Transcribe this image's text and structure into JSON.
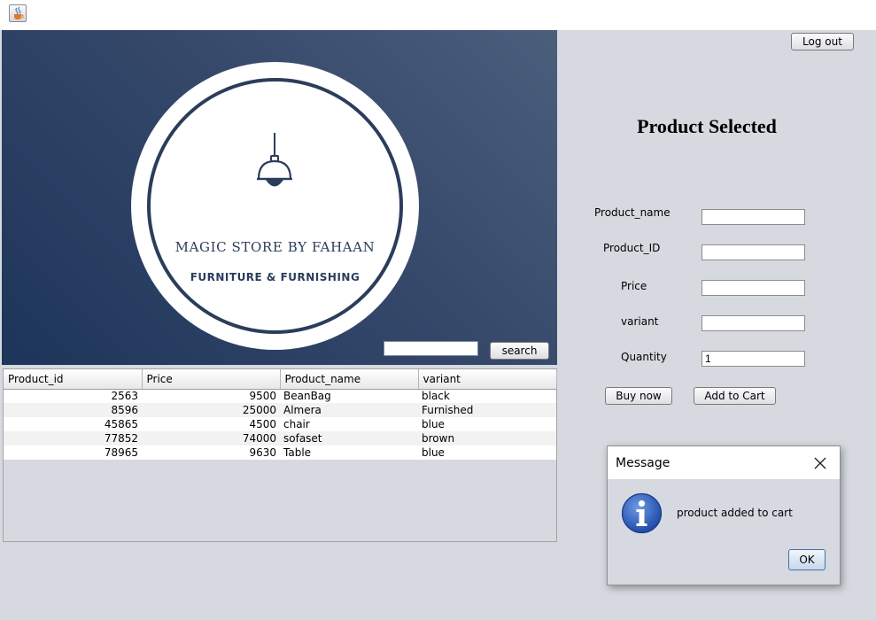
{
  "window": {
    "icon": "java-cup-icon"
  },
  "banner": {
    "logo_icon": "lamp-icon",
    "logo_title": "MAGIC STORE BY FAHAAN",
    "logo_subtitle": "FURNITURE & FURNISHING",
    "search_value": "",
    "search_button": "search"
  },
  "table": {
    "columns": [
      "Product_id",
      "Price",
      "Product_name",
      "variant"
    ],
    "rows": [
      [
        "2563",
        "9500",
        "BeanBag",
        "black"
      ],
      [
        "8596",
        "25000",
        "Almera",
        "Furnished"
      ],
      [
        "45865",
        "4500",
        "chair",
        "blue"
      ],
      [
        "77852",
        "74000",
        "sofaset",
        "brown"
      ],
      [
        "78965",
        "9630",
        "Table",
        "blue"
      ]
    ]
  },
  "panel": {
    "logout": "Log out",
    "heading": "Product Selected",
    "fields": [
      {
        "label": "Product_name",
        "value": ""
      },
      {
        "label": "Product_ID",
        "value": ""
      },
      {
        "label": "Price",
        "value": ""
      },
      {
        "label": "variant",
        "value": ""
      },
      {
        "label": "Quantity",
        "value": "1"
      }
    ],
    "buy_now": "Buy now",
    "add_to_cart": "Add to Cart"
  },
  "dialog": {
    "title": "Message",
    "icon": "info-icon",
    "message": "product added to cart",
    "ok": "OK"
  },
  "colors": {
    "banner_dark": "#1d355a",
    "banner_light": "#4b5e7c",
    "logo_navy": "#2b3d5a",
    "info_blue": "#2a56b8"
  }
}
